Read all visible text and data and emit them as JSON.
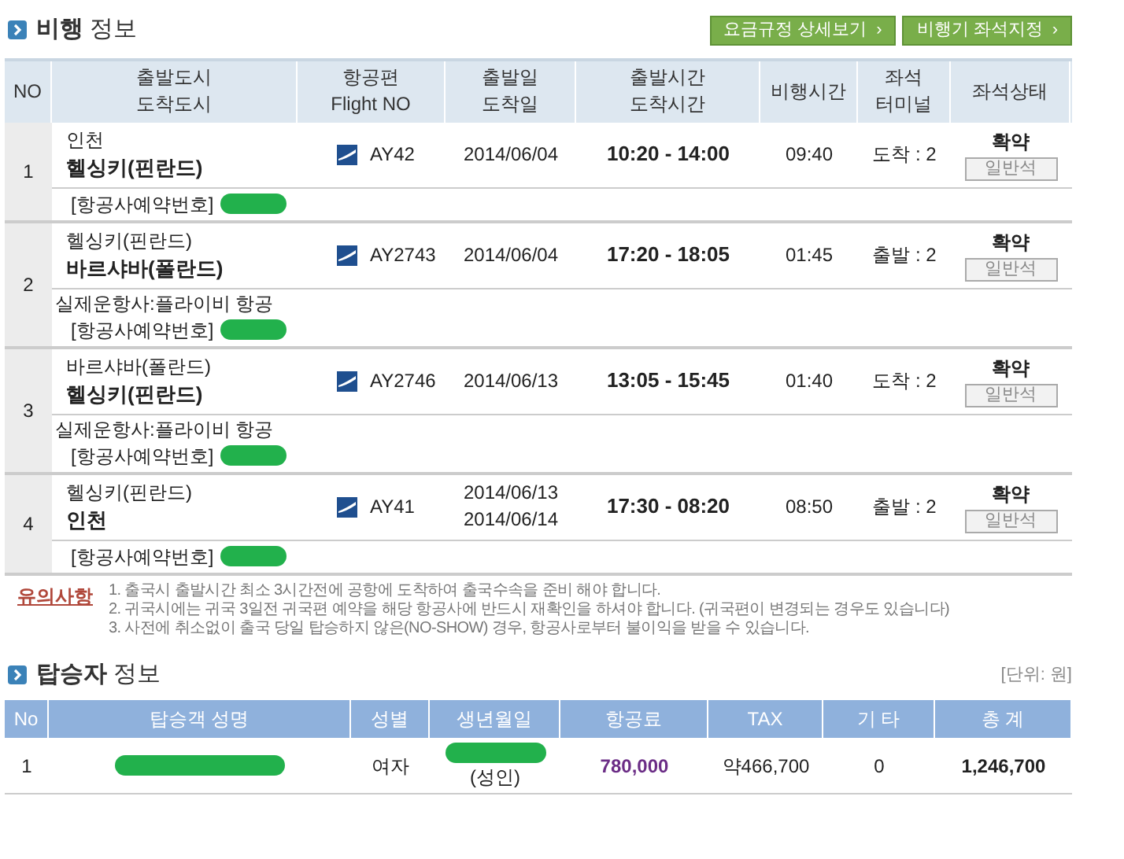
{
  "flight_section": {
    "title": "**비행** 정보",
    "buttons": [
      "요금규정 상세보기",
      "비행기 좌석지정"
    ],
    "arrow": "›"
  },
  "flight_table": {
    "columns": [
      [
        "NO"
      ],
      [
        "출발도시",
        "도착도시"
      ],
      [
        "항공편",
        "Flight NO"
      ],
      [
        "출발일",
        "도착일"
      ],
      [
        "출발시간",
        "도착시간"
      ],
      [
        "비행시간"
      ],
      [
        "좌석",
        "터미널"
      ],
      [
        "좌석상태"
      ]
    ],
    "rows": [
      {
        "no": "1",
        "from": "인천",
        "to": "헬싱키(핀란드)",
        "flight_no": "AY42",
        "dates": [
          "2014/06/04"
        ],
        "time": "10:20 - 14:00",
        "duration": "09:40",
        "terminal": "도착 : 2",
        "status": "확약",
        "seat_class": "일반석",
        "reservation_label": "[항공사예약번호]"
      },
      {
        "no": "2",
        "from": "헬싱키(핀란드)",
        "to": "바르샤바(폴란드)",
        "flight_no": "AY2743",
        "dates": [
          "2014/06/04"
        ],
        "time": "17:20 - 18:05",
        "duration": "01:45",
        "terminal": "출발 : 2",
        "status": "확약",
        "seat_class": "일반석",
        "operator": "실제운항사:플라이비 항공",
        "reservation_label": "[항공사예약번호]"
      },
      {
        "no": "3",
        "from": "바르샤바(폴란드)",
        "to": "헬싱키(핀란드)",
        "flight_no": "AY2746",
        "dates": [
          "2014/06/13"
        ],
        "time": "13:05 - 15:45",
        "duration": "01:40",
        "terminal": "도착 : 2",
        "status": "확약",
        "seat_class": "일반석",
        "operator": "실제운항사:플라이비 항공",
        "reservation_label": "[항공사예약번호]"
      },
      {
        "no": "4",
        "from": "헬싱키(핀란드)",
        "to": "인천",
        "flight_no": "AY41",
        "dates": [
          "2014/06/13",
          "2014/06/14"
        ],
        "time": "17:30 - 08:20",
        "duration": "08:50",
        "terminal": "출발 : 2",
        "status": "확약",
        "seat_class": "일반석",
        "reservation_label": "[항공사예약번호]"
      }
    ]
  },
  "notes": {
    "label": "유의사항",
    "items": [
      "1. 출국시 출발시간 최소 3시간전에 공항에 도착하여 출국수속을 준비 해야 합니다.",
      "2. 귀국시에는 귀국 3일전 귀국편 예약을 해당 항공사에 반드시 재확인을 하셔야 합니다. (귀국편이 변경되는 경우도 있습니다)",
      "3. 사전에 취소없이 출국 당일 탑승하지 않은(NO-SHOW) 경우, 항공사로부터 불이익을 받을 수 있습니다."
    ]
  },
  "passenger_section": {
    "title": "**탑승자** 정보",
    "unit": "[단위: 원]"
  },
  "passenger_table": {
    "columns": [
      "No",
      "탑승객 성명",
      "성별",
      "생년월일",
      "항공료",
      "TAX",
      "기 타",
      "총 계"
    ],
    "rows": [
      {
        "no": "1",
        "gender": "여자",
        "birth_note": "(성인)",
        "fare": "780,000",
        "tax": "약466,700",
        "other": "0",
        "total": "1,246,700"
      }
    ]
  }
}
